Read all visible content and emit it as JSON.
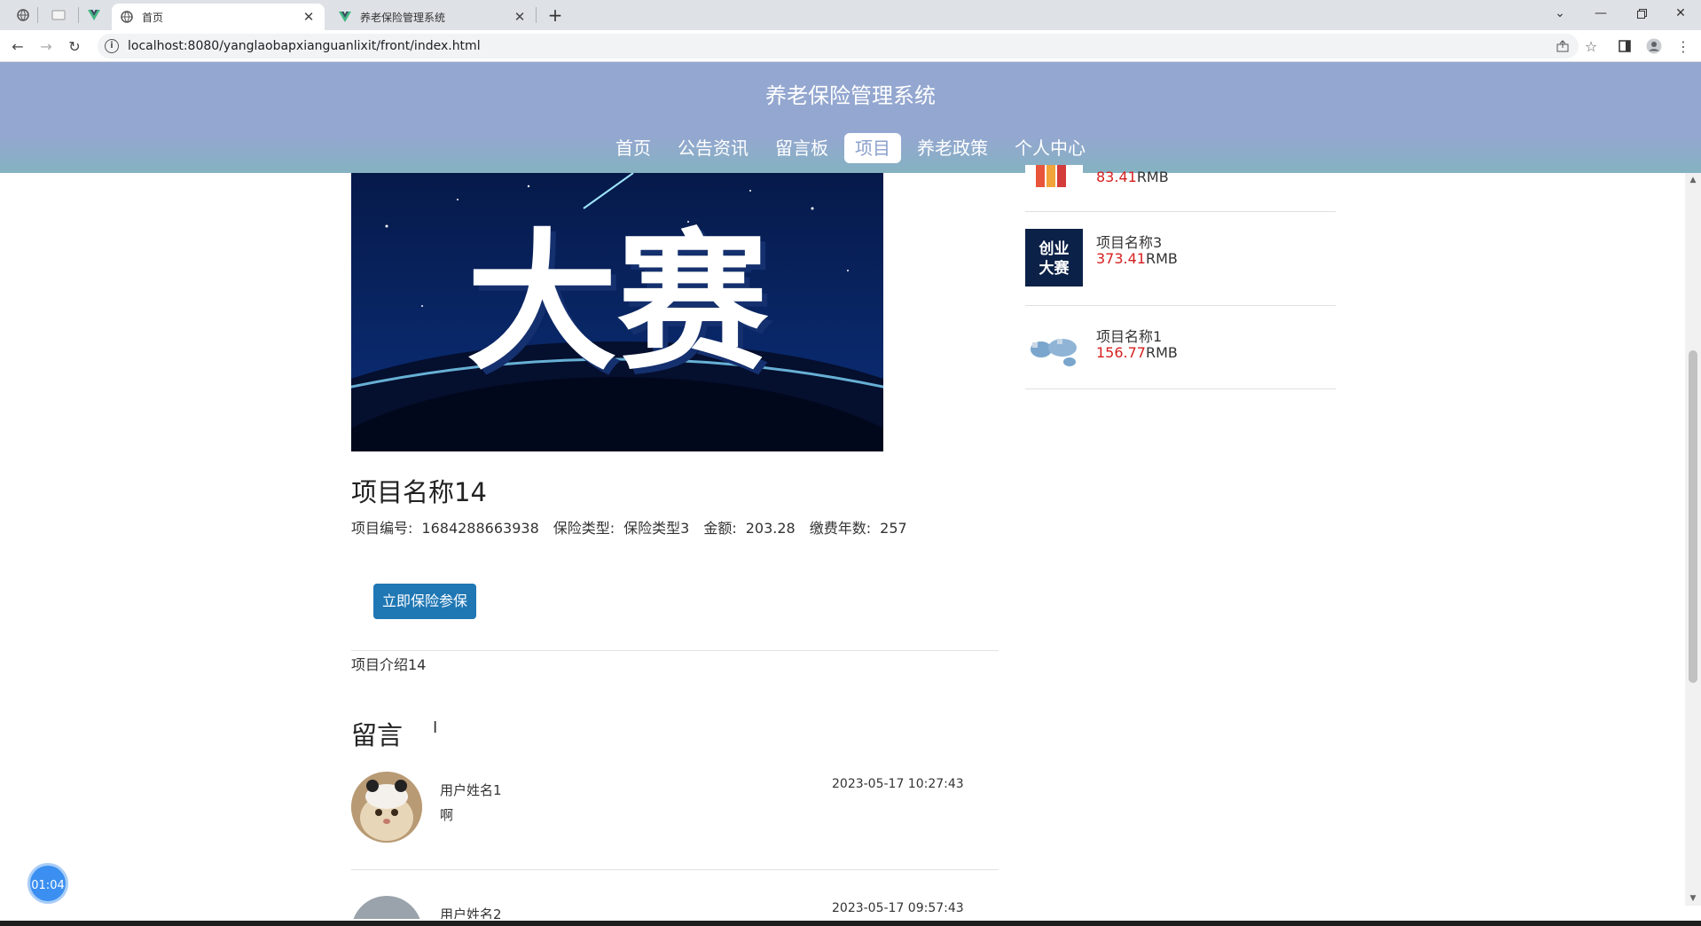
{
  "browser": {
    "tabs": [
      {
        "title": "首页",
        "active": true
      },
      {
        "title": "养老保险管理系统",
        "active": false
      }
    ],
    "url": "localhost:8080/yanglaobapxianguanlixit/front/index.html"
  },
  "site": {
    "title": "养老保险管理系统",
    "nav": [
      "首页",
      "公告资讯",
      "留言板",
      "项目",
      "养老政策",
      "个人中心"
    ],
    "active_nav_index": 3
  },
  "banner": {
    "text": "大赛"
  },
  "product": {
    "title": "项目名称14",
    "meta": [
      {
        "label": "项目编号:",
        "value": "1684288663938"
      },
      {
        "label": "保险类型:",
        "value": "保险类型3"
      },
      {
        "label": "金额:",
        "value": "203.28"
      },
      {
        "label": "缴费年数:",
        "value": "257"
      }
    ],
    "buy_label": "立即保险参保",
    "intro": "项目介绍14"
  },
  "comments": {
    "title": "留言",
    "items": [
      {
        "user": "用户姓名1",
        "text": "啊",
        "time": "2023-05-17 10:27:43"
      },
      {
        "user": "用户姓名2",
        "text": "",
        "time": "2023-05-17 09:57:43"
      }
    ]
  },
  "sidebar": {
    "items": [
      {
        "name": "",
        "price": "83.41",
        "unit": "RMB",
        "thumb": "chart-thumb"
      },
      {
        "name": "项目名称3",
        "price": "373.41",
        "unit": "RMB",
        "thumb": "创业大赛",
        "thumb_line1": "创业",
        "thumb_line2": "大赛"
      },
      {
        "name": "项目名称1",
        "price": "156.77",
        "unit": "RMB",
        "thumb": "world-map-thumb"
      }
    ]
  },
  "timer": "01:04",
  "colors": {
    "header_top": "#94a7d0",
    "header_bottom": "#22d672",
    "price": "#d61f1f",
    "button": "#1f77b4"
  }
}
